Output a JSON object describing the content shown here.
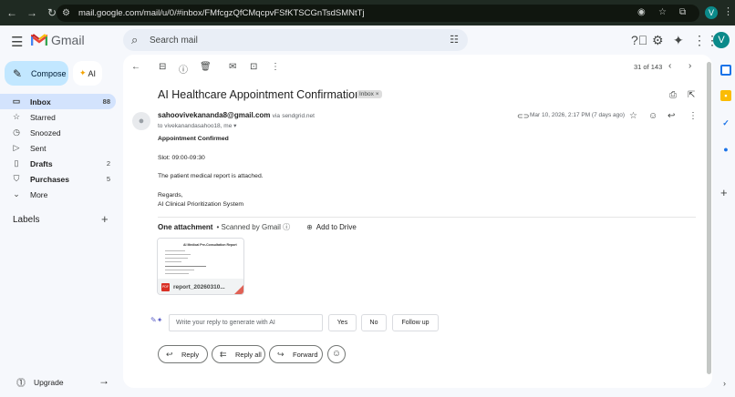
{
  "browser": {
    "url": "mail.google.com/mail/u/0/#inbox/FMfcgzQfCMqcpvFSfKTSCGnTsdSMNtTj",
    "profile_initial": "V"
  },
  "app": {
    "brand": "Gmail",
    "search_placeholder": "Search mail",
    "account_initial": "V"
  },
  "sidebar": {
    "compose_label": "Compose",
    "ai_label": "AI",
    "items": [
      {
        "label": "Inbox",
        "count": "88",
        "icon": "inbox-icon"
      },
      {
        "label": "Starred",
        "count": "",
        "icon": "star-icon"
      },
      {
        "label": "Snoozed",
        "count": "",
        "icon": "clock-icon"
      },
      {
        "label": "Sent",
        "count": "",
        "icon": "send-icon"
      },
      {
        "label": "Drafts",
        "count": "2",
        "icon": "draft-icon"
      },
      {
        "label": "Purchases",
        "count": "5",
        "icon": "tag-icon"
      },
      {
        "label": "More",
        "count": "",
        "icon": "chevron-down-icon"
      }
    ],
    "labels_heading": "Labels",
    "upgrade_label": "Upgrade"
  },
  "toolbar": {
    "pager_text": "31 of 143"
  },
  "email": {
    "subject": "AI Healthcare Appointment Confirmation",
    "folder_chip": "Inbox ×",
    "sender_email": "sahoovivekananda8@gmail.com",
    "via_prefix": "via",
    "via_domain": "sendgrid.net",
    "to_line": "to vivekanandasahoo18, me ▾",
    "date": "Mar 10, 2026, 2:17 PM (7 days ago)",
    "body": {
      "heading": "Appointment Confirmed",
      "slot": "Slot: 09:00-09:30",
      "line": "The patient medical report is attached.",
      "regards": "Regards,",
      "signature": "AI Clinical Prioritization System"
    },
    "attachments": {
      "count_label": "One attachment",
      "scanned_label": "• Scanned by Gmail ⓘ",
      "add_to_drive": "Add to Drive",
      "preview_title": "AI Medical Pre-Consultation Report",
      "file_name": "report_20260310...",
      "file_type": "PDF"
    }
  },
  "reply": {
    "input_placeholder": "Write your reply to generate with AI",
    "suggestions": [
      "Yes",
      "No",
      "Follow up"
    ],
    "actions": [
      "Reply",
      "Reply all",
      "Forward"
    ]
  }
}
